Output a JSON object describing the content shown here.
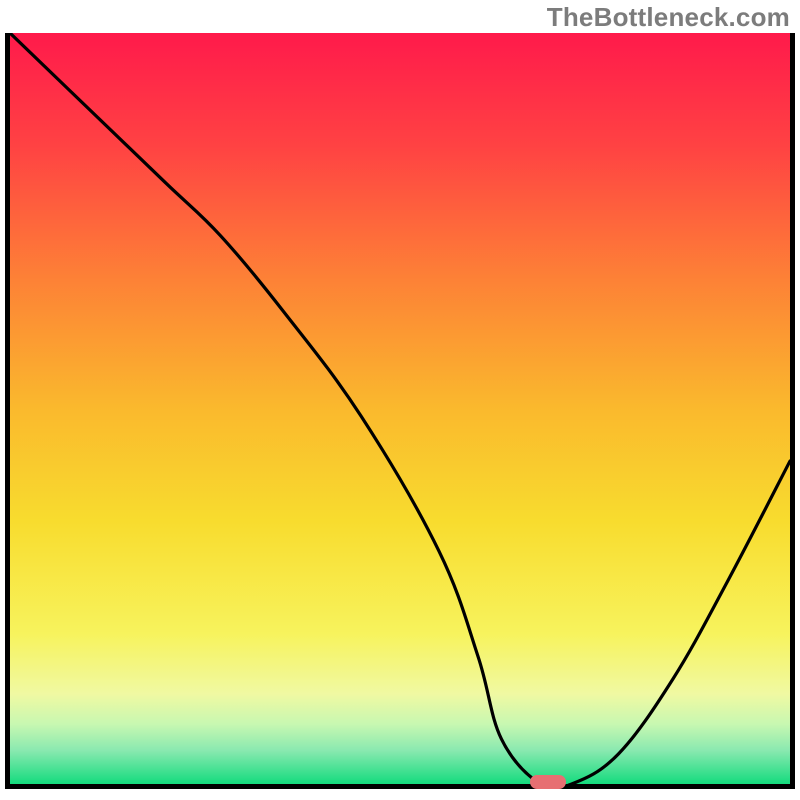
{
  "watermark": {
    "text": "TheBottleneck.com"
  },
  "chart_data": {
    "type": "line",
    "title": "",
    "xlabel": "",
    "ylabel": "",
    "xlim": [
      0,
      100
    ],
    "ylim": [
      0,
      100
    ],
    "grid": false,
    "gradient_stops": [
      {
        "offset": 0.0,
        "color": "#ff1a4b"
      },
      {
        "offset": 0.15,
        "color": "#ff4243"
      },
      {
        "offset": 0.33,
        "color": "#fd8236"
      },
      {
        "offset": 0.5,
        "color": "#fab92d"
      },
      {
        "offset": 0.65,
        "color": "#f8dc2e"
      },
      {
        "offset": 0.8,
        "color": "#f7f35d"
      },
      {
        "offset": 0.88,
        "color": "#f0f9a2"
      },
      {
        "offset": 0.92,
        "color": "#c8f8b1"
      },
      {
        "offset": 0.955,
        "color": "#8ae9b0"
      },
      {
        "offset": 1.0,
        "color": "#14db7e"
      }
    ],
    "series": [
      {
        "name": "bottleneck-curve",
        "x": [
          0,
          10,
          20,
          27,
          35,
          45,
          55,
          60,
          63,
          68,
          72,
          78,
          85,
          92,
          100
        ],
        "y": [
          100,
          90,
          80,
          73,
          63,
          49,
          31,
          17,
          6,
          0,
          0,
          4,
          14,
          27,
          43
        ]
      }
    ],
    "marker": {
      "x": 69,
      "y": 0,
      "name": "optimal-point"
    }
  }
}
